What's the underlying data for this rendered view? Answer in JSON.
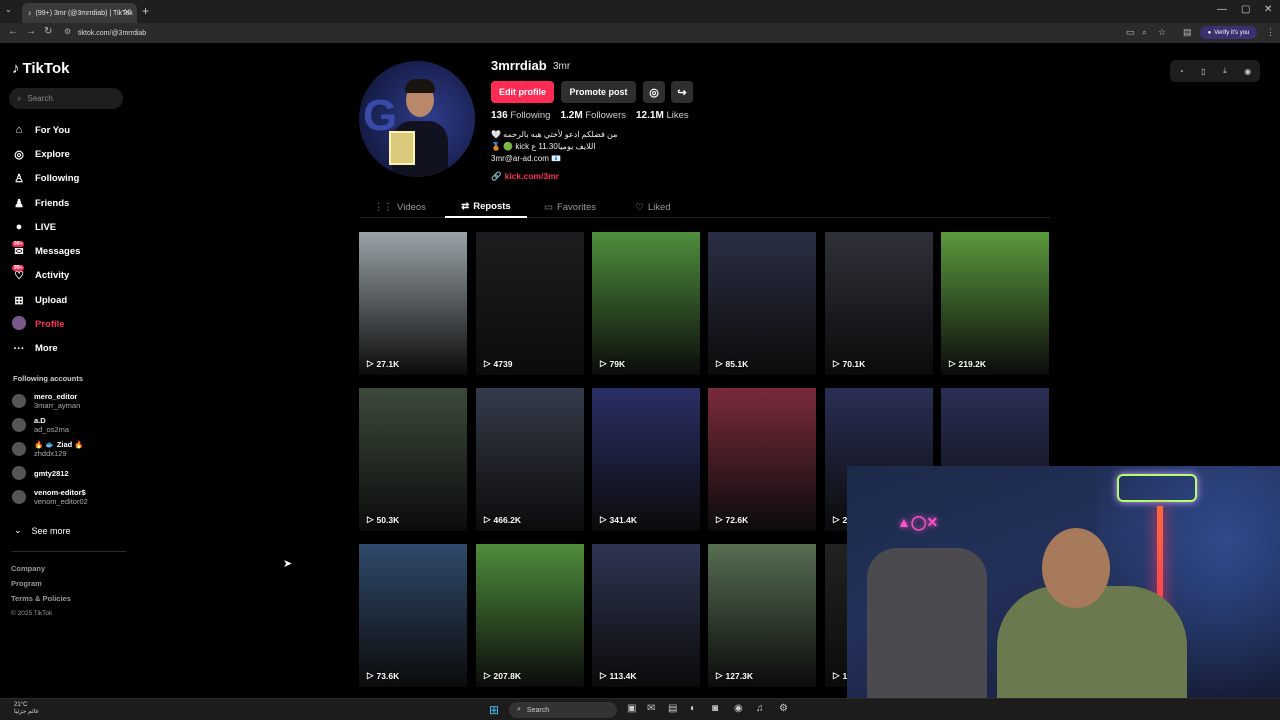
{
  "browser": {
    "tab_title": "(99+) 3mr (@3mrrdiab) | TikTok",
    "url": "tiktok.com/@3mrrdiab",
    "verify_label": "Verify it's you"
  },
  "sidebar": {
    "logo": "TikTok",
    "search_placeholder": "Search",
    "nav": [
      {
        "label": "For You",
        "icon": "home-icon"
      },
      {
        "label": "Explore",
        "icon": "compass-icon"
      },
      {
        "label": "Following",
        "icon": "following-icon"
      },
      {
        "label": "Friends",
        "icon": "friends-icon"
      },
      {
        "label": "LIVE",
        "icon": "live-icon"
      },
      {
        "label": "Messages",
        "icon": "messages-icon",
        "badge": "99+"
      },
      {
        "label": "Activity",
        "icon": "activity-icon",
        "badge": "99+"
      },
      {
        "label": "Upload",
        "icon": "upload-icon"
      },
      {
        "label": "Profile",
        "icon": "profile-avatar-icon"
      },
      {
        "label": "More",
        "icon": "more-icon"
      }
    ],
    "following_title": "Following accounts",
    "following": [
      {
        "username": "mero_editor",
        "handle": "3marr_ayman"
      },
      {
        "username": "a.D",
        "handle": "ad_os2ma"
      },
      {
        "username": "🔥 🐟 Ziad 🔥",
        "handle": "zhddx129"
      },
      {
        "username": "gmty2812",
        "handle": ""
      },
      {
        "username": "venom-editor$",
        "handle": "venom_editor02"
      }
    ],
    "see_more": "See more",
    "footer": [
      "Company",
      "Program",
      "Terms & Policies"
    ],
    "copyright": "© 2025 TikTok"
  },
  "profile": {
    "username": "3mrrdiab",
    "nickname": "3mr",
    "edit_label": "Edit profile",
    "promote_label": "Promote post",
    "following_count": "136",
    "following_label": "Following",
    "followers_count": "1.2M",
    "followers_label": "Followers",
    "likes_count": "12.1M",
    "likes_label": "Likes",
    "bio": [
      "من فضلكم ادعو لأختي هبه بالرحمه 🤍",
      "اللايف يوميا11.30 ع kick 🟢 🥉",
      "3mr@ar-ad.com 📧"
    ],
    "link": "kick.com/3mr"
  },
  "tabs": [
    {
      "label": "Videos",
      "icon": "grid-icon"
    },
    {
      "label": "Reposts",
      "icon": "repost-icon"
    },
    {
      "label": "Favorites",
      "icon": "bookmark-icon"
    },
    {
      "label": "Liked",
      "icon": "heart-icon"
    }
  ],
  "videos": [
    {
      "views": "27.1K",
      "bg": "#9aa3a8"
    },
    {
      "views": "4739",
      "bg": "#1d1d1f"
    },
    {
      "views": "79K",
      "bg": "#4e8f3c"
    },
    {
      "views": "85.1K",
      "bg": "#2b2f45"
    },
    {
      "views": "70.1K",
      "bg": "#30303a"
    },
    {
      "views": "219.2K",
      "bg": "#5b9a3e"
    },
    {
      "views": "50.3K",
      "bg": "#3c4a3a"
    },
    {
      "views": "466.2K",
      "bg": "#353b4a"
    },
    {
      "views": "341.4K",
      "bg": "#2a2f66"
    },
    {
      "views": "72.6K",
      "bg": "#7a2a3a"
    },
    {
      "views": "2",
      "bg": "#2a2f55"
    },
    {
      "views": "",
      "bg": "#2a2f55"
    },
    {
      "views": "73.6K",
      "bg": "#2f4a6a"
    },
    {
      "views": "207.8K",
      "bg": "#4f8d3c"
    },
    {
      "views": "113.4K",
      "bg": "#2e3552"
    },
    {
      "views": "127.3K",
      "bg": "#566e52"
    },
    {
      "views": "1",
      "bg": "#222"
    },
    {
      "views": "",
      "bg": "#222"
    }
  ],
  "taskbar": {
    "temp": "21°C",
    "weather_text": "غائم جزئيا",
    "search_label": "Search"
  },
  "accent": "#fe2c55"
}
